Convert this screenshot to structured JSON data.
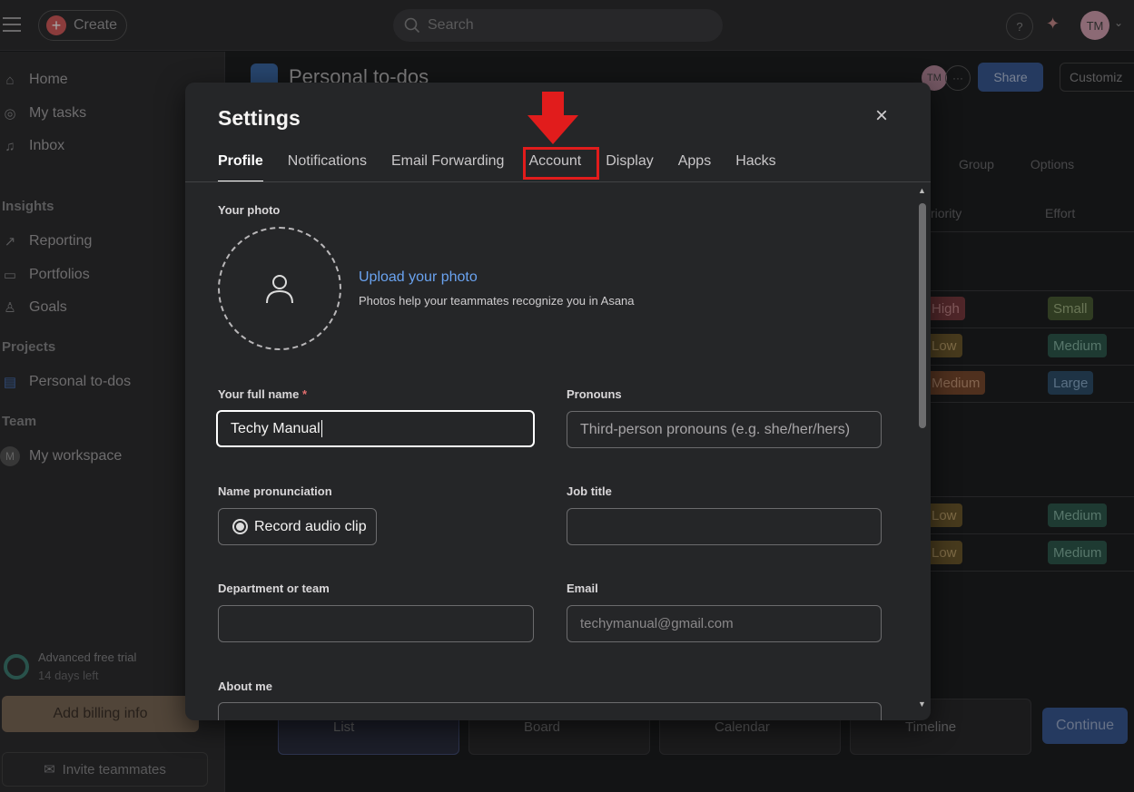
{
  "topbar": {
    "create_label": "Create",
    "search_placeholder": "Search",
    "help_label": "?",
    "avatar_initials": "TM"
  },
  "sidebar": {
    "items": [
      {
        "label": "Home",
        "icon": "home-icon"
      },
      {
        "label": "My tasks",
        "icon": "check-circle-icon"
      },
      {
        "label": "Inbox",
        "icon": "bell-icon"
      }
    ],
    "insights_heading": "Insights",
    "insights": [
      {
        "label": "Reporting",
        "icon": "chart-line-icon"
      },
      {
        "label": "Portfolios",
        "icon": "folder-icon"
      },
      {
        "label": "Goals",
        "icon": "person-icon"
      }
    ],
    "projects_heading": "Projects",
    "projects": [
      {
        "label": "Personal to-dos",
        "icon": "list-icon"
      }
    ],
    "team_heading": "Team",
    "team": [
      {
        "label": "My workspace",
        "avatar": "M"
      }
    ],
    "trial_title": "Advanced free trial",
    "trial_days": "14 days left",
    "billing_label": "Add billing info",
    "invite_label": "Invite teammates"
  },
  "project": {
    "title": "Personal to-dos",
    "member_initials": "TM",
    "more_label": "···",
    "share_label": "Share",
    "customize_label": "Customiz",
    "group_label": "Group",
    "options_label": "Options",
    "col_priority": "riority",
    "col_effort": "Effort",
    "rows": [
      {
        "priority": "High",
        "effort": "Small"
      },
      {
        "priority": "Low",
        "effort": "Medium"
      },
      {
        "priority": "Medium",
        "effort": "Large"
      },
      {
        "priority": "Low",
        "effort": "Medium"
      },
      {
        "priority": "Low",
        "effort": "Medium"
      }
    ],
    "views": [
      "List",
      "Board",
      "Calendar",
      "Timeline"
    ],
    "continue_label": "Continue"
  },
  "settings": {
    "title": "Settings",
    "close_label": "×",
    "tabs": [
      "Profile",
      "Notifications",
      "Email Forwarding",
      "Account",
      "Display",
      "Apps",
      "Hacks"
    ],
    "active_tab": "Profile",
    "highlighted_tab": "Account",
    "photo_label": "Your photo",
    "upload_link": "Upload your photo",
    "upload_help": "Photos help your teammates recognize you in Asana",
    "full_name_label": "Your full name",
    "required_mark": "*",
    "full_name_value": "Techy Manual",
    "pronouns_label": "Pronouns",
    "pronouns_placeholder": "Third-person pronouns (e.g. she/her/hers)",
    "pronunciation_label": "Name pronunciation",
    "record_label": "Record audio clip",
    "job_title_label": "Job title",
    "job_title_value": "",
    "department_label": "Department or team",
    "department_value": "",
    "email_label": "Email",
    "email_value": "techymanual@gmail.com",
    "about_label": "About me"
  },
  "colors": {
    "accent_link": "#6aa3f0",
    "highlight_red": "#e11c1c",
    "modal_bg": "#252628"
  }
}
